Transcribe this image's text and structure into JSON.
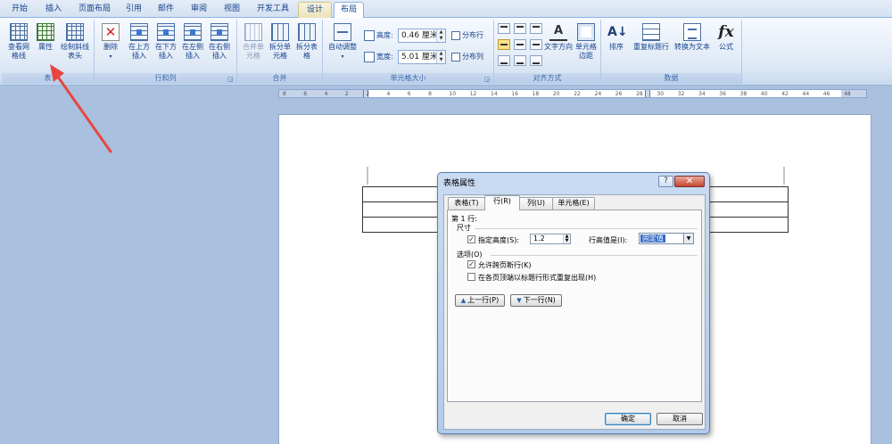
{
  "tabs": [
    "开始",
    "插入",
    "页面布局",
    "引用",
    "邮件",
    "审阅",
    "视图",
    "开发工具",
    "设计",
    "布局"
  ],
  "ribbon": {
    "groups": {
      "table": "表",
      "rows_cols": "行和列",
      "merge": "合并",
      "cell_size": "单元格大小",
      "alignment": "对齐方式",
      "data": "数据"
    },
    "buttons": {
      "gridlines": "查看网格线",
      "properties": "属性",
      "draw_diag": "绘制斜线表头",
      "delete": "删除",
      "insert_above": "在上方插入",
      "insert_below": "在下方插入",
      "insert_left": "在左侧插入",
      "insert_right": "在右侧插入",
      "merge_cells": "合并单元格",
      "split_cells": "拆分单元格",
      "split_table": "拆分表格",
      "autofit": "自动调整",
      "distribute_rows": "分布行",
      "distribute_cols": "分布列",
      "text_direction": "文字方向",
      "cell_margins": "单元格边距",
      "sort": "排序",
      "repeat_header": "重复标题行",
      "convert_text": "转换为文本",
      "formula": "公式"
    },
    "height_label": "高度:",
    "height_value": "0.46 厘米",
    "width_label": "宽度:",
    "width_value": "5.01 厘米"
  },
  "ruler_numbers": [
    "8",
    "6",
    "4",
    "2",
    "2",
    "4",
    "6",
    "8",
    "10",
    "12",
    "14",
    "16",
    "18",
    "20",
    "22",
    "24",
    "26",
    "28",
    "30",
    "32",
    "34",
    "36",
    "38",
    "40",
    "42",
    "44",
    "46",
    "48"
  ],
  "dialog": {
    "title": "表格属性",
    "help": "?",
    "close": "✕",
    "tabs": [
      "表格(T)",
      "行(R)",
      "列(U)",
      "单元格(E)"
    ],
    "row_label": "第 1 行:",
    "size_section": "尺寸",
    "specify_height_label": "指定高度(S):",
    "specify_height_checked": true,
    "height_value": "1.2",
    "row_height_is_label": "行高值是(I):",
    "row_height_mode": "固定值",
    "options_section": "选项(O)",
    "allow_break_label": "允许跨页断行(K)",
    "allow_break_checked": true,
    "repeat_header_label": "在各页顶端以标题行形式重复出现(H)",
    "repeat_header_checked": false,
    "prev_row": "上一行(P)",
    "next_row": "下一行(N)",
    "ok": "确定",
    "cancel": "取消"
  },
  "colors": {
    "annotation_arrow": "#e8473f",
    "ribbon_accent": "#15428b",
    "selection": "#3169c6"
  }
}
